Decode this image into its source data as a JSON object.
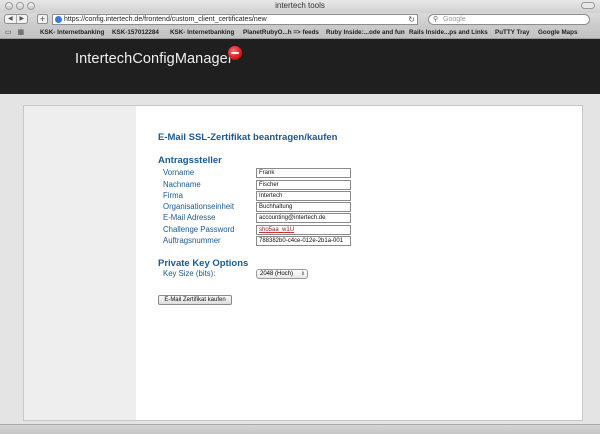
{
  "window": {
    "title": "intertech tools"
  },
  "toolbar": {
    "back_glyph": "◀",
    "forward_glyph": "▶",
    "add_glyph": "+",
    "url": "https://config.intertech.de/frontend/custom_client_certificates/new",
    "search_placeholder": "Google"
  },
  "bookmarks": [
    "KSK- Internetbanking",
    "KSK-157012284",
    "KSK- Internetbanking",
    "PlanetRubyO...h => feeds",
    "Ruby Inside:...ode and fun",
    "Rails Inside...ps and Links",
    "PuTTY Tray",
    "Google Maps"
  ],
  "header": {
    "brand": "IntertechConfigManager"
  },
  "form": {
    "title": "E-Mail SSL-Zertifikat beantragen/kaufen",
    "applicant_section": "Antragssteller",
    "fields": [
      {
        "label": "Vorname",
        "value": "Frank"
      },
      {
        "label": "Nachname",
        "value": "Fischer"
      },
      {
        "label": "Firma",
        "value": "Intertech"
      },
      {
        "label": "Organisationseinheit",
        "value": "Buchhaltung"
      },
      {
        "label": "E-Mail Adresse",
        "value": "accounting@intertech.de"
      },
      {
        "label": "Challenge Password",
        "value": "sho5aa_w1U"
      },
      {
        "label": "Auftragsnummer",
        "value": "788382b0-c4ce-012e-2b1a-001"
      }
    ],
    "key_section": "Private Key Options",
    "key_size_label": "Key Size (bits):",
    "key_size_value": "2048 (Hoch)",
    "submit_label": "E-Mail Zertifikat kaufen"
  },
  "colors": {
    "accent": "#1a5a90",
    "header_bg": "#1f1f1f",
    "logo_red": "#cc1111"
  }
}
